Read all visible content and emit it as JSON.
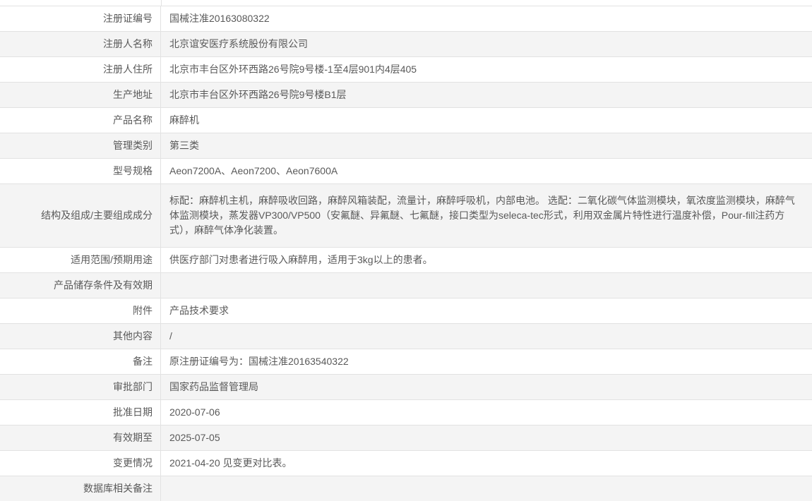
{
  "colors": {
    "border": "#e2e2e2",
    "row_alt_background": "#f4f4f4",
    "text": "#595959",
    "page_background": "#ffffff"
  },
  "table": {
    "rows": [
      {
        "label": "注册证编号",
        "value": "国械注准20163080322"
      },
      {
        "label": "注册人名称",
        "value": "北京谊安医疗系统股份有限公司"
      },
      {
        "label": "注册人住所",
        "value": "北京市丰台区外环西路26号院9号楼-1至4层901内4层405"
      },
      {
        "label": "生产地址",
        "value": "北京市丰台区外环西路26号院9号楼B1层"
      },
      {
        "label": "产品名称",
        "value": "麻醉机"
      },
      {
        "label": "管理类别",
        "value": "第三类"
      },
      {
        "label": "型号规格",
        "value": "Aeon7200A、Aeon7200、Aeon7600A"
      },
      {
        "label": "结构及组成/主要组成成分",
        "value": "标配：麻醉机主机，麻醉吸收回路，麻醉风箱装配，流量计，麻醉呼吸机，内部电池。 选配：二氧化碳气体监测模块，氧浓度监测模块，麻醉气体监测模块，蒸发器VP300/VP500（安氟醚、异氟醚、七氟醚，接口类型为seleca-tec形式，利用双金属片特性进行温度补偿，Pour-fill注药方式），麻醉气体净化装置。"
      },
      {
        "label": "适用范围/预期用途",
        "value": "供医疗部门对患者进行吸入麻醉用，适用于3kg以上的患者。"
      },
      {
        "label": "产品储存条件及有效期",
        "value": ""
      },
      {
        "label": "附件",
        "value": "产品技术要求"
      },
      {
        "label": "其他内容",
        "value": "/"
      },
      {
        "label": "备注",
        "value": "原注册证编号为：国械注准20163540322"
      },
      {
        "label": "审批部门",
        "value": "国家药品监督管理局"
      },
      {
        "label": "批准日期",
        "value": "2020-07-06"
      },
      {
        "label": "有效期至",
        "value": "2025-07-05"
      },
      {
        "label": "变更情况",
        "value": "2021-04-20 见变更对比表。"
      },
      {
        "label": "数据库相关备注",
        "value": ""
      }
    ]
  }
}
